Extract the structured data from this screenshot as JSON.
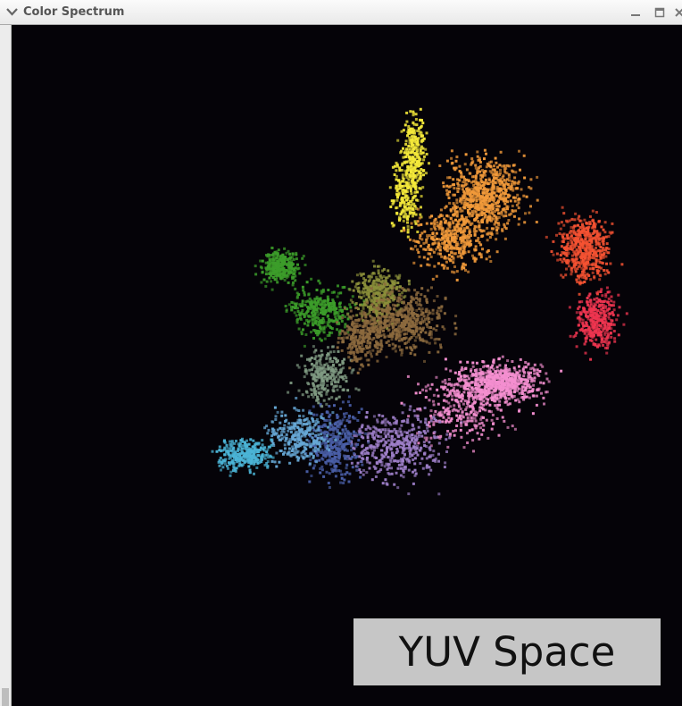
{
  "window": {
    "title": "Color Spectrum",
    "controls": [
      "minimize",
      "maximize",
      "close"
    ]
  },
  "viewport": {
    "background": "#050308",
    "label": "YUV Space",
    "clusters": [
      {
        "name": "yellow",
        "color": "#f4e93a"
      },
      {
        "name": "orange",
        "color": "#f19a3a"
      },
      {
        "name": "red-orange",
        "color": "#f55232"
      },
      {
        "name": "red",
        "color": "#ef3550"
      },
      {
        "name": "pink",
        "color": "#f48fd0"
      },
      {
        "name": "purple",
        "color": "#9e7fc9"
      },
      {
        "name": "dark-blue",
        "color": "#4a5fa8"
      },
      {
        "name": "blue",
        "color": "#67a8d6"
      },
      {
        "name": "cyan",
        "color": "#4bb4d6"
      },
      {
        "name": "gray-green",
        "color": "#7f9a82"
      },
      {
        "name": "green",
        "color": "#3c9d2a"
      },
      {
        "name": "olive",
        "color": "#8a8f3a"
      },
      {
        "name": "brown",
        "color": "#8c6a3e"
      }
    ]
  }
}
